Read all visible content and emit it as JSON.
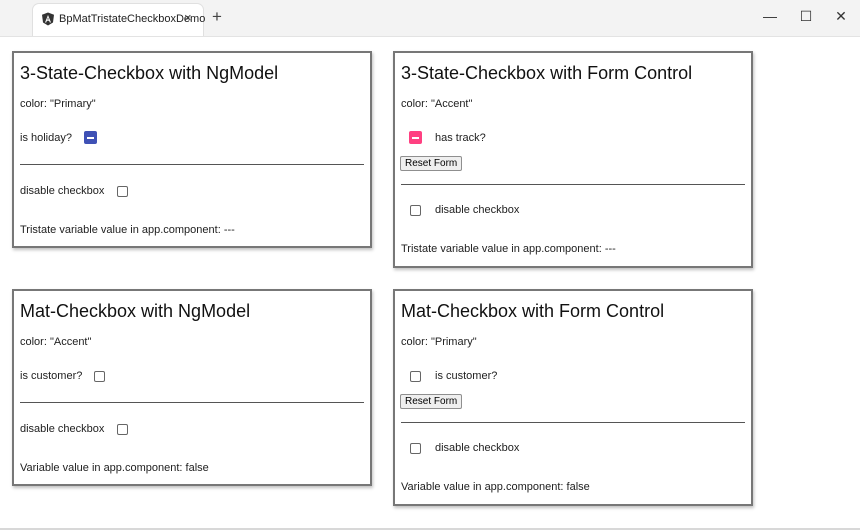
{
  "window": {
    "tab_title": "BpMatTristateCheckboxDemo",
    "tab_close": "×",
    "new_tab": "+",
    "minimize": "—",
    "maximize": "☐",
    "close": "✕"
  },
  "colors": {
    "primary": "#3f51b5",
    "accent": "#ff4081"
  },
  "cards": {
    "tristate_ngmodel": {
      "title": "3-State-Checkbox with NgModel",
      "color": "color: \"Primary\"",
      "checkbox_label": "is holiday?",
      "checkbox_state": "indeterminate",
      "disable_label": "disable checkbox",
      "value_text": "Tristate variable value in app.component:  ---"
    },
    "tristate_form": {
      "title": "3-State-Checkbox with Form Control",
      "color": "color: \"Accent\"",
      "checkbox_label": "has track?",
      "checkbox_state": "indeterminate",
      "reset_label": "Reset Form",
      "disable_label": "disable checkbox",
      "value_text": "Tristate variable value in app.component:  ---"
    },
    "mat_ngmodel": {
      "title": "Mat-Checkbox with NgModel",
      "color": "color: \"Accent\"",
      "checkbox_label": "is customer?",
      "checkbox_state": "unchecked",
      "disable_label": "disable checkbox",
      "value_text": "Variable value in app.component:  false"
    },
    "mat_form": {
      "title": "Mat-Checkbox with Form Control",
      "color": "color: \"Primary\"",
      "checkbox_label": "is customer?",
      "checkbox_state": "unchecked",
      "reset_label": "Reset Form",
      "disable_label": "disable checkbox",
      "value_text": "Variable value in app.component:  false"
    }
  }
}
